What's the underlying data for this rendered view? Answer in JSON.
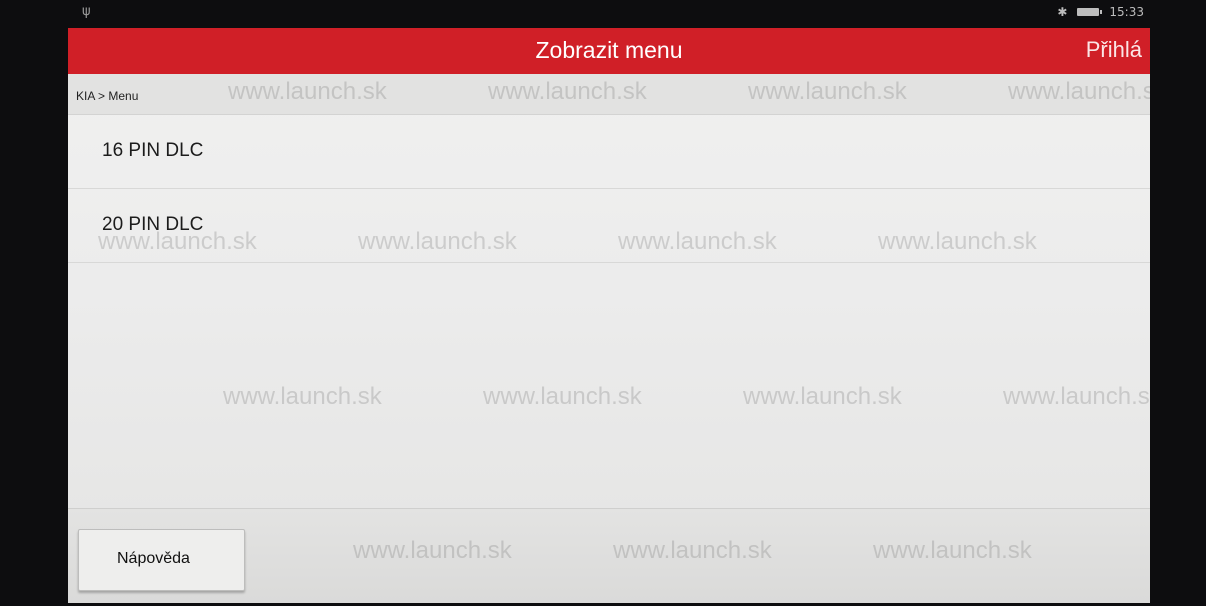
{
  "status_bar": {
    "time": "15:33",
    "left_icon": "signal-icon",
    "bluetooth_icon": "bluetooth-icon"
  },
  "header": {
    "title": "Zobrazit menu",
    "login_label": "Přihlá"
  },
  "breadcrumb": "KIA > Menu",
  "menu": {
    "items": [
      {
        "label": "16 PIN DLC"
      },
      {
        "label": "20 PIN DLC"
      }
    ]
  },
  "footer": {
    "help_label": "Nápověda"
  },
  "watermark": "www.launch.sk",
  "colors": {
    "appbar": "#d01f27",
    "screen_bg": "#ececec"
  }
}
